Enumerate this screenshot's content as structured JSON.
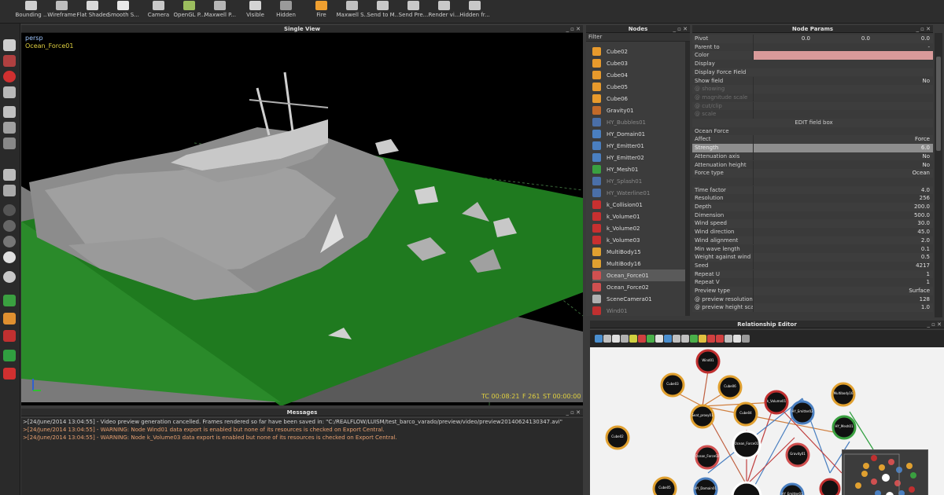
{
  "toolbar": {
    "items": [
      {
        "label": "Bounding ...",
        "icon": "bounding-box-icon",
        "color": "#cfcfcf"
      },
      {
        "label": "Wireframe",
        "icon": "wireframe-icon",
        "color": "#bdbdbd"
      },
      {
        "label": "Flat Shaded",
        "icon": "flat-shaded-icon",
        "color": "#d9d9d9"
      },
      {
        "label": "Smooth S...",
        "icon": "smooth-shaded-icon",
        "color": "#e8e8e8"
      },
      {
        "label": "Camera",
        "icon": "camera-icon",
        "color": "#c8c8c8"
      },
      {
        "label": "OpenGL P...",
        "icon": "opengl-preview-icon",
        "color": "#9bbd5e"
      },
      {
        "label": "Maxwell P...",
        "icon": "maxwell-preview-icon",
        "color": "#b6b6b6"
      },
      {
        "label": "Visible",
        "icon": "visible-icon",
        "color": "#d4d4d4"
      },
      {
        "label": "Hidden",
        "icon": "hidden-icon",
        "color": "#9a9a9a"
      },
      {
        "label": "Fire",
        "icon": "fire-icon",
        "color": "#f0a030"
      },
      {
        "label": "Maxwell S...",
        "icon": "maxwell-studio-icon",
        "color": "#c0c0c0"
      },
      {
        "label": "Send to M...",
        "icon": "send-to-maxwell-icon",
        "color": "#c8c8c8"
      },
      {
        "label": "Send Pre...",
        "icon": "send-preview-icon",
        "color": "#c8c8c8"
      },
      {
        "label": "Render vi...",
        "icon": "render-view-icon",
        "color": "#c8c8c8"
      },
      {
        "label": "Hidden fr...",
        "icon": "hidden-frame-icon",
        "color": "#c8c8c8"
      }
    ]
  },
  "viewport": {
    "title": "Single View",
    "camera_label": "persp",
    "node_label": "Ocean_Force01",
    "tc": "TC 00:08:21",
    "frame": "F 261",
    "st": "ST 00:00:00"
  },
  "messages": {
    "title": "Messages",
    "lines": [
      {
        "text": ">[24/June/2014 13:04:55] - Video preview generation cancelled. Frames rendered so far have been saved in: \"C:/REALFLOW/LUISM/test_barco_varado/preview/video/preview20140624130347.avi\"",
        "color": "#d6d6d6"
      },
      {
        "text": ">[24/June/2014 13:04:55] - WARNING: Node Wind01 data export is enabled but none of its resources is checked on Export Central.",
        "color": "#e8a070"
      },
      {
        "text": ">[24/June/2014 13:04:55] - WARNING: Node k_Volume03 data export is enabled but none of its resources is checked on Export Central.",
        "color": "#e8a070"
      }
    ]
  },
  "nodes": {
    "title": "Nodes",
    "filter_label": "Filter",
    "items": [
      {
        "name": "Cube02",
        "icon": "cube-icon",
        "color": "#e89a2c",
        "state": "normal"
      },
      {
        "name": "Cube03",
        "icon": "cube-icon",
        "color": "#e89a2c",
        "state": "normal"
      },
      {
        "name": "Cube04",
        "icon": "cube-icon",
        "color": "#e89a2c",
        "state": "normal"
      },
      {
        "name": "Cube05",
        "icon": "cube-icon",
        "color": "#e89a2c",
        "state": "normal"
      },
      {
        "name": "Cube06",
        "icon": "cube-icon",
        "color": "#e89a2c",
        "state": "normal"
      },
      {
        "name": "Gravity01",
        "icon": "gravity-icon",
        "color": "#c26a2a",
        "state": "normal"
      },
      {
        "name": "HY_Bubbles01",
        "icon": "bubbles-icon",
        "color": "#4a6fa8",
        "state": "dim"
      },
      {
        "name": "HY_Domain01",
        "icon": "domain-icon",
        "color": "#4a7fc0",
        "state": "normal"
      },
      {
        "name": "HY_Emitter01",
        "icon": "emitter-icon",
        "color": "#4a7fc0",
        "state": "normal"
      },
      {
        "name": "HY_Emitter02",
        "icon": "emitter-icon",
        "color": "#4a7fc0",
        "state": "normal"
      },
      {
        "name": "HY_Mesh01",
        "icon": "mesh-icon",
        "color": "#3aa040",
        "state": "normal"
      },
      {
        "name": "HY_Splash01",
        "icon": "splash-icon",
        "color": "#4a6fa8",
        "state": "dim"
      },
      {
        "name": "HY_Waterline01",
        "icon": "waterline-icon",
        "color": "#4a6fa8",
        "state": "dim"
      },
      {
        "name": "k_Collision01",
        "icon": "collision-icon",
        "color": "#c83030",
        "state": "normal"
      },
      {
        "name": "k_Volume01",
        "icon": "volume-icon",
        "color": "#c83030",
        "state": "normal"
      },
      {
        "name": "k_Volume02",
        "icon": "volume-icon",
        "color": "#c83030",
        "state": "normal"
      },
      {
        "name": "k_Volume03",
        "icon": "volume-icon",
        "color": "#c83030",
        "state": "normal"
      },
      {
        "name": "MultiBody15",
        "icon": "multibody-icon",
        "color": "#e0a030",
        "state": "normal"
      },
      {
        "name": "MultiBody16",
        "icon": "multibody-icon",
        "color": "#e0a030",
        "state": "normal"
      },
      {
        "name": "Ocean_Force01",
        "icon": "ocean-force-icon",
        "color": "#d05050",
        "state": "selected"
      },
      {
        "name": "Ocean_Force02",
        "icon": "ocean-force-icon",
        "color": "#d05050",
        "state": "normal"
      },
      {
        "name": "SceneCamera01",
        "icon": "camera-icon",
        "color": "#b0b0b0",
        "state": "normal"
      },
      {
        "name": "Wind01",
        "icon": "wind-icon",
        "color": "#c03030",
        "state": "dim"
      }
    ]
  },
  "params": {
    "title": "Node Params",
    "rows": [
      {
        "k": "Pivot",
        "v": [
          "0.0",
          "0.0",
          "0.0"
        ],
        "type": "triple"
      },
      {
        "k": "Parent to",
        "v": "-",
        "type": "value"
      },
      {
        "k": "Color",
        "v": "",
        "type": "color",
        "swatch": "#d99a9a"
      },
      {
        "k": "Display",
        "type": "section"
      },
      {
        "k": "Display Force Field",
        "type": "section"
      },
      {
        "k": "Show field",
        "v": "No",
        "type": "value"
      },
      {
        "k": "@ showing",
        "v": "",
        "type": "dim"
      },
      {
        "k": "@ magnitude scale",
        "v": "",
        "type": "dim"
      },
      {
        "k": "@ cut/clip",
        "v": "",
        "type": "dim"
      },
      {
        "k": "@ scale",
        "v": "",
        "type": "dim"
      },
      {
        "k": "EDIT field box",
        "type": "center"
      },
      {
        "k": "Ocean Force",
        "type": "section"
      },
      {
        "k": "Affect",
        "v": "Force",
        "type": "value"
      },
      {
        "k": "Strength",
        "v": "6.0",
        "type": "highlight"
      },
      {
        "k": "Attenuation axis",
        "v": "No",
        "type": "value"
      },
      {
        "k": "Attenuation height",
        "v": "No",
        "type": "value"
      },
      {
        "k": "Force type",
        "v": "Ocean",
        "type": "value"
      },
      {
        "k": "",
        "v": "",
        "type": "value"
      },
      {
        "k": "Time factor",
        "v": "4.0",
        "type": "value"
      },
      {
        "k": "Resolution",
        "v": "256",
        "type": "value"
      },
      {
        "k": "Depth",
        "v": "200.0",
        "type": "value"
      },
      {
        "k": "Dimension",
        "v": "500.0",
        "type": "value"
      },
      {
        "k": "Wind speed",
        "v": "30.0",
        "type": "value"
      },
      {
        "k": "Wind direction",
        "v": "45.0",
        "type": "value"
      },
      {
        "k": "Wind alignment",
        "v": "2.0",
        "type": "value"
      },
      {
        "k": "Min wave length",
        "v": "0.1",
        "type": "value"
      },
      {
        "k": "Weight against wind",
        "v": "0.5",
        "type": "value"
      },
      {
        "k": "Seed",
        "v": "4217",
        "type": "value"
      },
      {
        "k": "Repeat U",
        "v": "1",
        "type": "value"
      },
      {
        "k": "Repeat V",
        "v": "1",
        "type": "value"
      },
      {
        "k": "Preview type",
        "v": "Surface",
        "type": "value"
      },
      {
        "k": "@ preview resolution",
        "v": "128",
        "type": "value"
      },
      {
        "k": "@ preview height scale",
        "v": "1.0",
        "type": "value"
      }
    ]
  },
  "relationship": {
    "title": "Relationship Editor",
    "nodes": [
      {
        "label": "Wind01",
        "ring": "#c03030",
        "fill": "#111"
      },
      {
        "label": "Cube03",
        "ring": "#e0a030",
        "fill": "#111"
      },
      {
        "label": "Cube06",
        "ring": "#e0a030",
        "fill": "#111"
      },
      {
        "label": "Cube04",
        "ring": "#e0a030",
        "fill": "#111"
      },
      {
        "label": "Cube02",
        "ring": "#e0a030",
        "fill": "#111"
      },
      {
        "label": "Seat_proxy01",
        "ring": "#e0a030",
        "fill": "#111"
      },
      {
        "label": "k_Volume01",
        "ring": "#c03030",
        "fill": "#111"
      },
      {
        "label": "HY_Emitter02",
        "ring": "#4a7fc0",
        "fill": "#111"
      },
      {
        "label": "Multibody16",
        "ring": "#e0a030",
        "fill": "#111"
      },
      {
        "label": "HY_Mesh01",
        "ring": "#3aa040",
        "fill": "#111"
      },
      {
        "label": "Ocean_Force01",
        "ring": "#ffffff",
        "fill": "#111"
      },
      {
        "label": "Ocean_Force02",
        "ring": "#d05050",
        "fill": "#111"
      },
      {
        "label": "Gravity01",
        "ring": "#d05050",
        "fill": "#111"
      },
      {
        "label": "Cube05",
        "ring": "#e0a030",
        "fill": "#111"
      },
      {
        "label": "HY_Domain01",
        "ring": "#4a7fc0",
        "fill": "#111"
      },
      {
        "label": "HY_Emitter01",
        "ring": "#4a7fc0",
        "fill": "#111"
      },
      {
        "label": "",
        "ring": "#ffffff",
        "fill": "#111"
      },
      {
        "label": "",
        "ring": "#c03030",
        "fill": "#111"
      }
    ]
  }
}
